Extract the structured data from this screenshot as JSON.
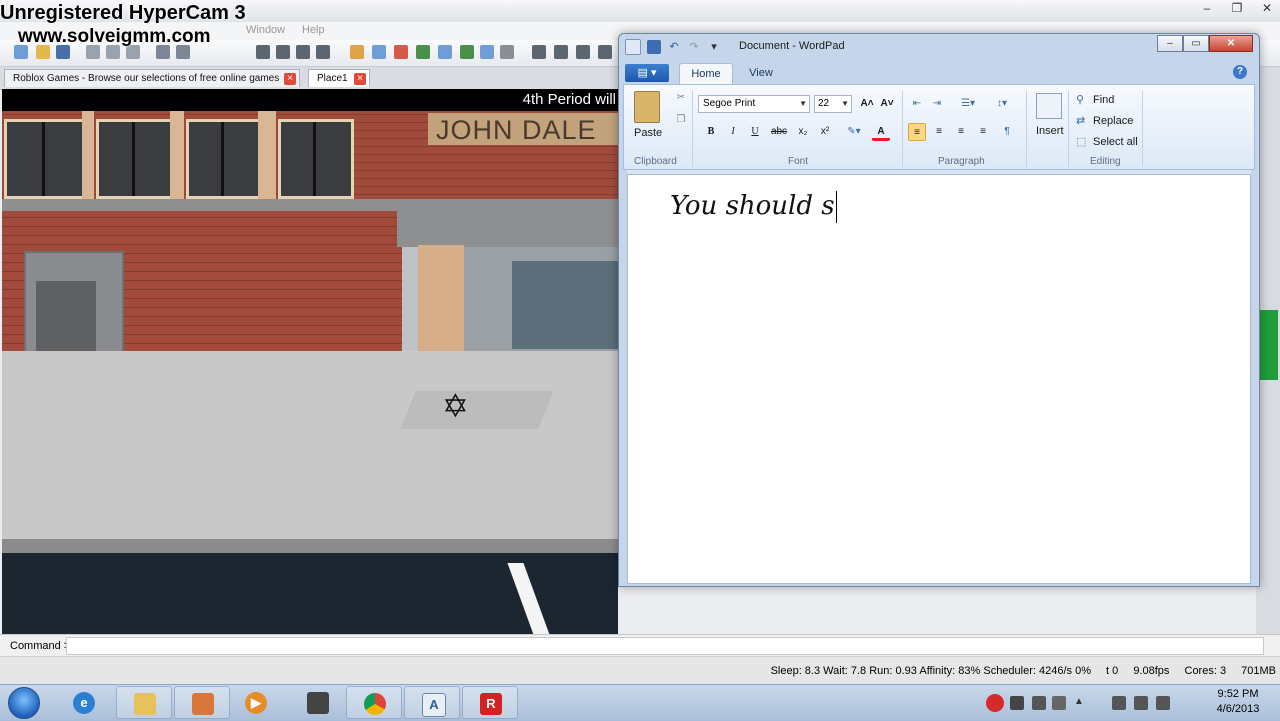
{
  "watermark": {
    "line1": "Unregistered HyperCam 3",
    "line2": "www.solveigmm.com"
  },
  "studio": {
    "menu": [
      "Window",
      "Help"
    ],
    "tabs": [
      {
        "label": "Roblox Games - Browse our selections of free online games",
        "close": "×"
      },
      {
        "label": "Place1",
        "close": "×"
      }
    ],
    "viewport": {
      "hud_text": "4th Period will",
      "sign_text": "JOHN DALE"
    },
    "command_label": "Command >",
    "status": {
      "stats": "Sleep: 8.3 Wait: 7.8 Run: 0.93 Affinity: 83% Scheduler: 4246/s 0%",
      "t": "t 0",
      "fps": "9.08fps",
      "cores": "Cores: 3",
      "mem": "701MB"
    },
    "window_buttons": [
      "–",
      "❐",
      "✕"
    ]
  },
  "wordpad": {
    "title": "Document - WordPad",
    "tabs": {
      "app": "▤ ▾",
      "home": "Home",
      "view": "View"
    },
    "help": "?",
    "window_buttons": {
      "minimize": "–",
      "maximize": "▭",
      "close": "✕"
    },
    "ribbon": {
      "clipboard": {
        "paste": "Paste",
        "group": "Clipboard"
      },
      "font": {
        "name": "Segoe Print",
        "size": "22",
        "group": "Font",
        "buttons": {
          "bold": "B",
          "italic": "I",
          "underline": "U",
          "strike": "abc",
          "subscript": "x₂",
          "superscript": "x²",
          "grow": "A˄",
          "shrink": "A˅",
          "color": "A"
        }
      },
      "paragraph": {
        "group": "Paragraph"
      },
      "insert": {
        "label": "Insert"
      },
      "editing": {
        "find": "Find",
        "replace": "Replace",
        "select_all": "Select all",
        "group": "Editing"
      }
    },
    "document_text": "You should s"
  },
  "taskbar": {
    "clock_time": "9:52 PM",
    "clock_date": "4/6/2013"
  }
}
